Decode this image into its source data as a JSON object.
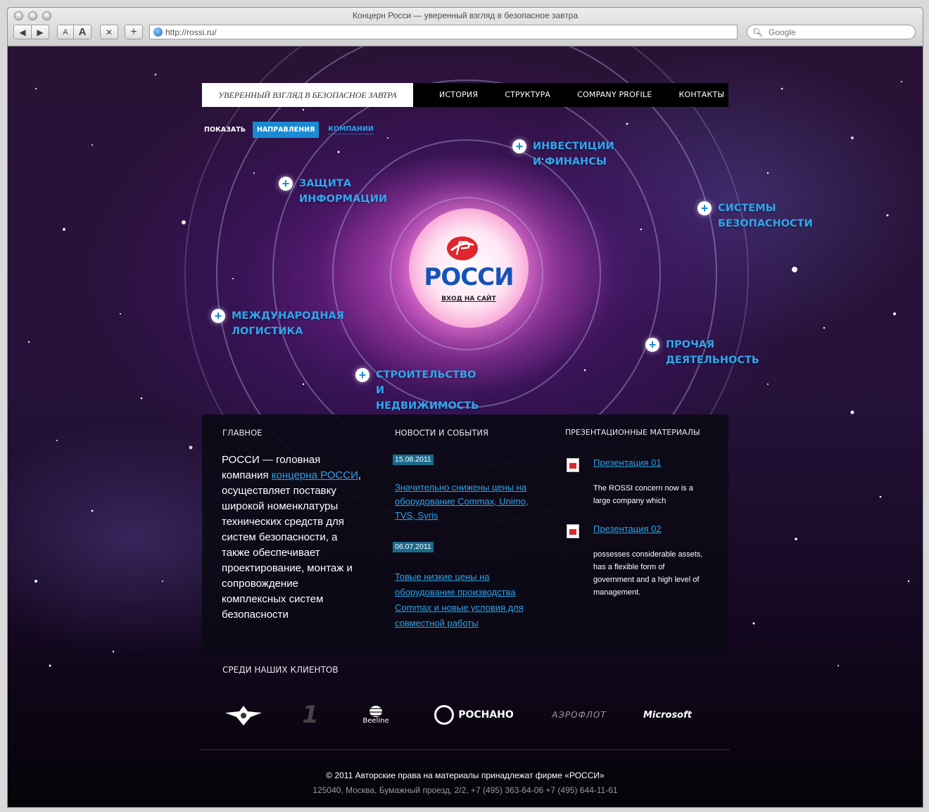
{
  "browser": {
    "window_title": "Концерн Росси — уверенный взгляд в безопасное завтра",
    "url": "http://rossi.ru/",
    "search_placeholder": "Google",
    "font_small": "A",
    "font_large": "A"
  },
  "nav": {
    "tagline": "УВЕРЕННЫЙ ВЗГЛЯД В БЕЗОПАСНОЕ ЗАВТРА",
    "items": [
      "ИСТОРИЯ",
      "СТРУКТУРА",
      "COMPANY PROFILE",
      "КОНТАКТЫ"
    ]
  },
  "show": {
    "label": "ПОКАЗАТЬ",
    "tab_active": "НАПРАВЛЕНИЯ",
    "tab_other": "КОМПАНИИ"
  },
  "sectors": [
    {
      "line1": "ИНВЕСТИЦИИ",
      "line2": "И ФИНАНСЫ"
    },
    {
      "line1": "ЗАЩИТА",
      "line2": "ИНФОРМАЦИИ"
    },
    {
      "line1": "СИСТЕМЫ",
      "line2": "БЕЗОПАСНОСТИ"
    },
    {
      "line1": "МЕЖДУНАРОДНАЯ",
      "line2": "ЛОГИСТИКА"
    },
    {
      "line1": "ПРОЧАЯ",
      "line2": "ДЕЯТЕЛЬНОСТЬ"
    },
    {
      "line1": "СТРОИТЕЛЬСТВО",
      "line2": "И НЕДВИЖИМОСТЬ"
    }
  ],
  "logo": {
    "name": "РОССИ",
    "enter_link": "ВХОД НА САЙТ"
  },
  "main": {
    "heading": "ГЛАВНОЕ",
    "text_before": "РОССИ — головная компания ",
    "link": "концерна РОССИ",
    "text_after": ",  осуществляет поставку широкой номенклатуры технических средств для систем безопасности, а также обеспечивает проектирование, монтаж и сопровождение комплексных систем безопасности"
  },
  "news": {
    "heading": "НОВОСТИ И СОБЫТИЯ",
    "items": [
      {
        "date": "15.08.2011",
        "title": "Значительно снижены цены на оборудование Commax, Unimo, TVS, Syris"
      },
      {
        "date": "06.07.2011",
        "title": "Товые низкие цены на оборудование производства Commax и новые условия для совместной работы"
      }
    ]
  },
  "presentations": {
    "heading": "ПРЕЗЕНТАЦИОННЫЕ МАТЕРИАЛЫ",
    "items": [
      {
        "title": "Презентация 01",
        "text": "The ROSSI concern now is a large company which"
      },
      {
        "title": "Презентация 02",
        "text": "possesses considerable assets, has a flexible form of government and a high level of management."
      }
    ]
  },
  "clients": {
    "heading": "СРЕДИ НАШИХ КЛИЕНТОВ",
    "logos": [
      {
        "icon": "eagle-emblem-icon",
        "label": ""
      },
      {
        "icon": "channel-one-icon",
        "label": "1"
      },
      {
        "icon": "beeline-icon",
        "label": "Beeline"
      },
      {
        "icon": "rosnano-icon",
        "label": "РОСНАНО"
      },
      {
        "icon": "aeroflot-icon",
        "label": "АЭРОФЛОТ"
      },
      {
        "icon": "microsoft-icon",
        "label": "Microsoft"
      }
    ]
  },
  "footer": {
    "copyright": "© 2011 Авторские права на материалы принадлежат фирме «РОССИ»",
    "address": "125040, Москва, Бумажный проезд, 2/2,  +7 (495) 363-64-06   +7 (495) 644-11-61"
  },
  "colors": {
    "accent": "#1a8bd2",
    "link": "#2aa2ea",
    "logo_red": "#e0262c",
    "logo_blue": "#1553b8"
  }
}
